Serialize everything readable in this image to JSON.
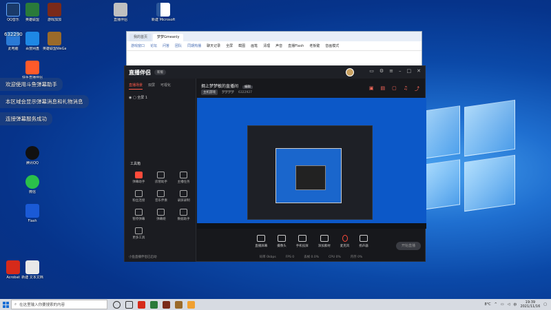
{
  "desktop": {
    "icons": [
      {
        "label": "QQ音乐",
        "color": "#1a3a6a"
      },
      {
        "label": "英雄联盟",
        "color": "#2a7a3a"
      },
      {
        "label": "游戏加加",
        "color": "#7a2a1a"
      },
      {
        "label": "直播伴侣",
        "color": "#c0c0c0"
      },
      {
        "label": "新建 Microsoft Word 文档",
        "color": "#2b579a"
      },
      {
        "label": "此电脑",
        "color": "#2a7ad6"
      },
      {
        "label": "百度网盘",
        "color": "#1e88e5"
      },
      {
        "label": "英雄联盟WeGame版",
        "color": "#9a6a2a"
      },
      {
        "label": "快手直播伴侣",
        "color": "#ff5a2a"
      },
      {
        "label": "腾讯QQ",
        "color": "#111"
      },
      {
        "label": "微信",
        "color": "#2ac04a"
      },
      {
        "label": "Flash",
        "color": "#1a5ad6"
      },
      {
        "label": "Acrobat",
        "color": "#d62a1a"
      },
      {
        "label": "新建 文本文档",
        "color": "#e8e8e8"
      }
    ],
    "badge_text": "632290"
  },
  "browser": {
    "tabs": [
      "我的首页",
      "梦梦Gmeanly"
    ],
    "toolbar_left": [
      "游戏窗口",
      "论坛",
      "问答",
      "团队",
      "同期热播"
    ],
    "toolbar_right": [
      "聊天记录",
      "全屏",
      "截图",
      "画笔",
      "清理",
      "声音",
      "直播Flash",
      "老板键",
      "音画模式"
    ]
  },
  "app": {
    "logo": "直播伴侣",
    "version": "新版",
    "sidebar": {
      "tabs": [
        "直播场景",
        "双屏",
        "可视化"
      ],
      "scene_label": "全屏 1",
      "tools_heading": "工具箱",
      "tools": [
        {
          "label": "弹幕助手",
          "red": true
        },
        {
          "label": "房管助手",
          "red": false
        },
        {
          "label": "主播任务",
          "red": false
        },
        {
          "label": "粉丝连接",
          "red": false
        },
        {
          "label": "音乐伴奏",
          "red": false
        },
        {
          "label": "录屏录制",
          "red": false
        },
        {
          "label": "暂停弹幕",
          "red": false
        },
        {
          "label": "弹幕姬",
          "red": false
        },
        {
          "label": "数据助手",
          "red": false
        },
        {
          "label": "更多工具",
          "red": false
        }
      ],
      "footer": "小鱼直播伴侣已启动"
    },
    "room": {
      "title": "拥上梦梦敏的直播间",
      "edit": "编辑",
      "category": "主机游戏",
      "meta1": "梦梦梦梦",
      "meta2": "6322927"
    },
    "controls": [
      "直播屏幕",
      "摄像头",
      "手机投屏",
      "添加素材",
      "麦克风",
      "扬声器"
    ],
    "start_label": "开始直播",
    "stats": [
      "码率 0kbps",
      "FPS 0",
      "丢帧 0.0%",
      "CPU 0%",
      "内存 0%"
    ]
  },
  "notifications": [
    "欢迎使用斗鱼弹幕助手",
    "本区域会显示弹幕消息和礼物消息",
    "连接弹幕服务成功"
  ],
  "taskbar": {
    "search_placeholder": "在这里输入你要搜索的内容",
    "temperature": "8°C",
    "ime": "中",
    "time": "19:39",
    "date": "2021/11/16"
  }
}
